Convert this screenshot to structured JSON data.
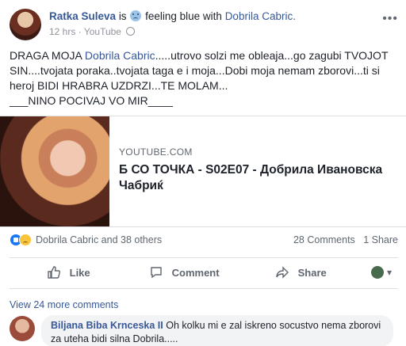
{
  "post": {
    "author": "Ratka Suleva",
    "is_text": "is",
    "feeling": "feeling blue with",
    "tagged": "Dobrila Cabric.",
    "time": "12 hrs",
    "via": "YouTube",
    "text_part1": "DRAGA MOJA ",
    "mention": "Dobrila Cabric",
    "text_part2": ".....utrovo solzi me obleaja...go zagubi TVOJOT SIN....tvojata poraka..tvojata taga e i moja...Dobi moja nemam zborovi...ti si heroj BIDI HRABRA UZDRZI...TE MOLAM...",
    "text_part3": "___NINO POCIVAJ VO MIR____"
  },
  "link": {
    "domain": "YOUTUBE.COM",
    "title": "Б СО ТОЧКА - S02E07 - Добрила Ивановска Чабриќ"
  },
  "reactions": {
    "names": "Dobrila Cabric and 38 others",
    "comments": "28 Comments",
    "shares": "1 Share"
  },
  "actions": {
    "like": "Like",
    "comment": "Comment",
    "share": "Share"
  },
  "comments": {
    "view_more": "View 24 more comments",
    "first_author": "Biljana Biba Krnceska II",
    "first_text": "Oh kolku mi e zal iskreno socustvo nema zborovi za uteha bidi silna Dobrila....."
  },
  "icons": {
    "more": "more-icon",
    "globe": "globe-icon",
    "like": "thumbs-up-icon",
    "comment": "comment-bubble-icon",
    "share": "share-arrow-icon",
    "reaction_like": "like-reaction-icon",
    "reaction_sad": "sad-reaction-icon"
  },
  "colors": {
    "link_blue": "#365899",
    "muted": "#606770",
    "like_blue": "#1877f2"
  }
}
